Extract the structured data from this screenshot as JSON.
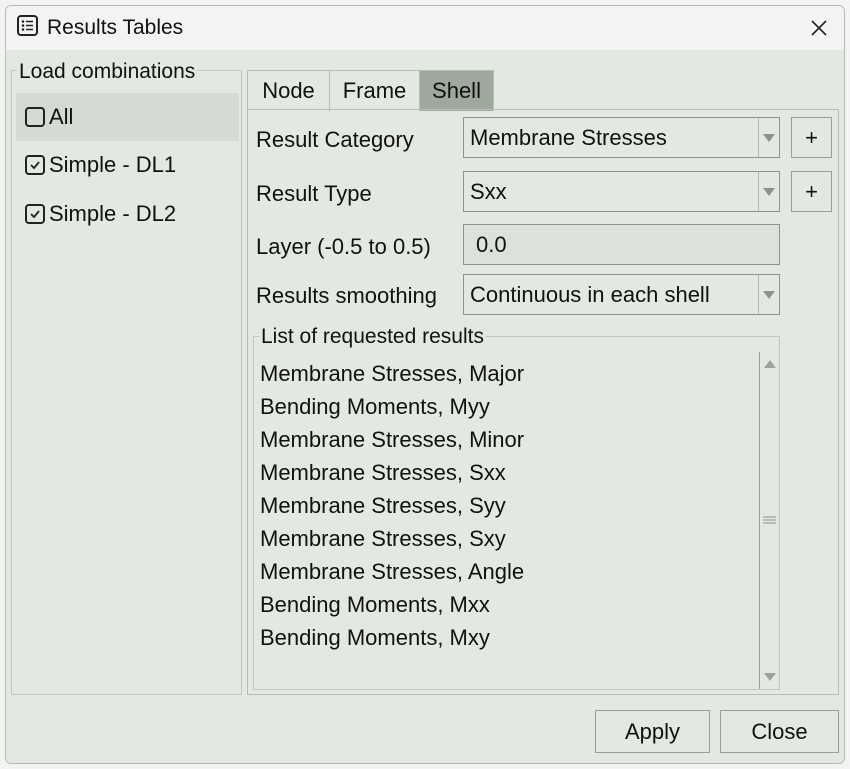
{
  "window": {
    "title": "Results Tables"
  },
  "load_combinations": {
    "title": "Load combinations",
    "items": [
      {
        "label": "All",
        "checked": false
      },
      {
        "label": "Simple - DL1",
        "checked": true
      },
      {
        "label": "Simple - DL2",
        "checked": true
      }
    ]
  },
  "tabs": [
    {
      "label": "Node",
      "active": false
    },
    {
      "label": "Frame",
      "active": false
    },
    {
      "label": "Shell",
      "active": true
    }
  ],
  "form": {
    "result_category_label": "Result Category",
    "result_category_value": "Membrane Stresses",
    "result_type_label": "Result Type",
    "result_type_value": "Sxx",
    "layer_label": "Layer (-0.5 to 0.5)",
    "layer_value": "0.0",
    "smoothing_label": "Results smoothing",
    "smoothing_value": "Continuous in each shell",
    "add_symbol": "+"
  },
  "requested": {
    "title": "List of requested results",
    "items": [
      "Membrane Stresses, Major",
      "Bending Moments, Myy",
      "Membrane Stresses, Minor",
      "Membrane Stresses, Sxx",
      "Membrane Stresses, Syy",
      "Membrane Stresses, Sxy",
      "Membrane Stresses, Angle",
      "Bending Moments, Mxx",
      "Bending Moments, Mxy"
    ]
  },
  "buttons": {
    "apply": "Apply",
    "close": "Close"
  },
  "icons": {
    "title": "table-list-icon",
    "close": "close-icon",
    "dropdown": "chevron-down-icon",
    "scroll_up": "triangle-up-icon",
    "scroll_down": "triangle-down-icon"
  },
  "colors": {
    "window_bg": "#e4e8e2",
    "active_tab": "#9ea89c",
    "selected_row": "#d6dad4"
  }
}
